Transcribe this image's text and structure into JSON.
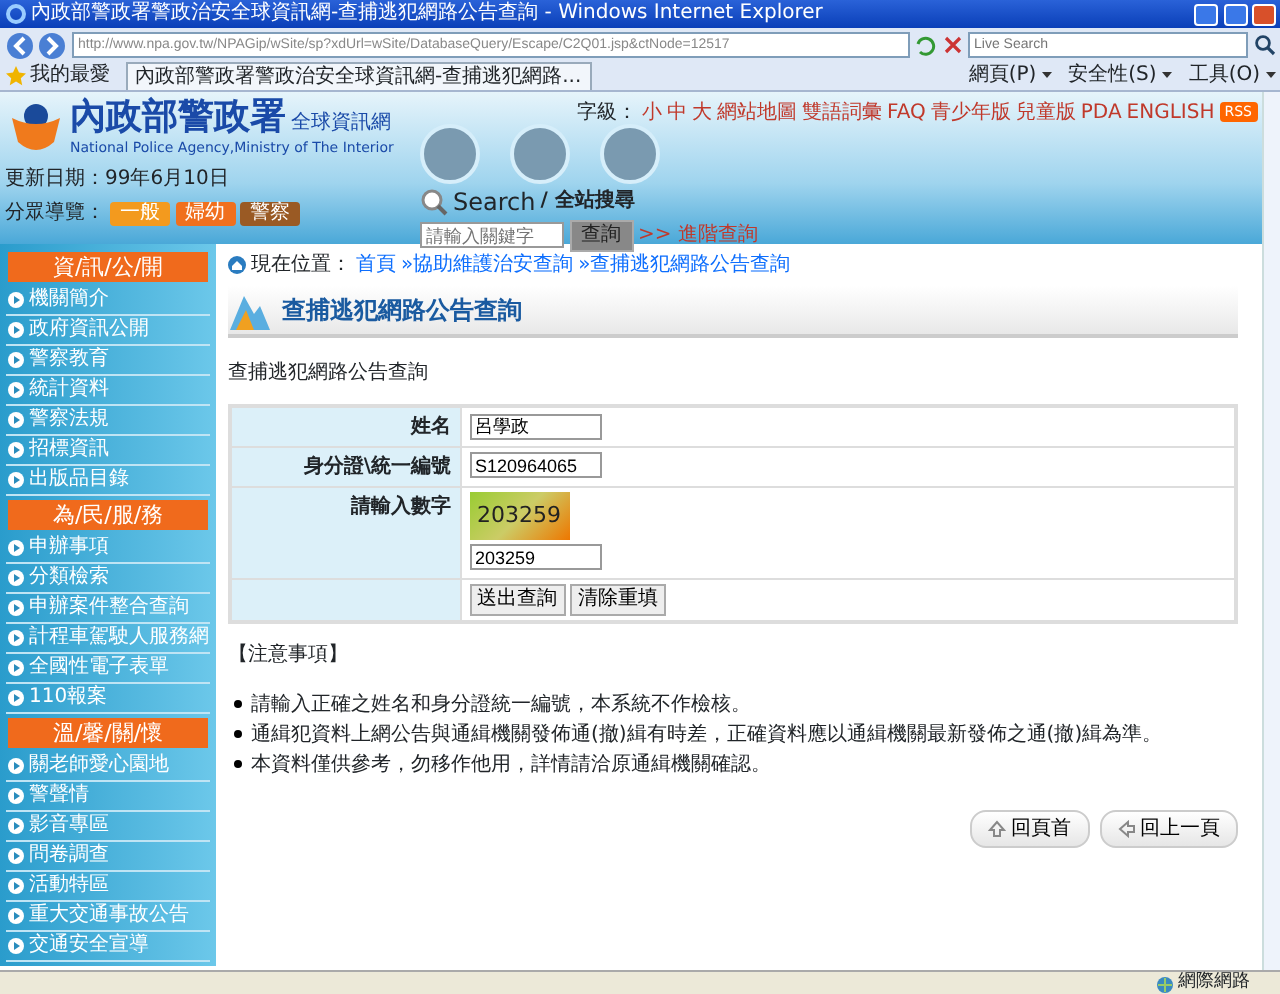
{
  "window": {
    "title": "內政部警政署警政治安全球資訊網-查捕逃犯網路公告查詢 - Windows Internet Explorer"
  },
  "browser": {
    "address": "http://www.npa.gov.tw/NPAGip/wSite/sp?xdUrl=wSite/DatabaseQuery/Escape/C2Q01.jsp&ctNode=12517",
    "search_placeholder": "Live Search",
    "favorites": "我的最愛",
    "tab_title": "內政部警政署警政治安全球資訊網-查捕逃犯網路...",
    "menus": [
      "網頁(P)",
      "安全性(S)",
      "工具(O)"
    ]
  },
  "header": {
    "font_size_label": "字級：",
    "font_sizes": [
      "小",
      "中",
      "大"
    ],
    "links": [
      "網站地圖",
      "雙語詞彙",
      "FAQ",
      "青少年版",
      "兒童版",
      "PDA",
      "ENGLISH"
    ],
    "rss": "RSS",
    "logo_title": "內政部警政署",
    "logo_subtitle": "全球資訊網",
    "logo_en": "National Police Agency,Ministry of The Interior",
    "updated": "更新日期：99年6月10日",
    "audience_label": "分眾導覽：",
    "audience": [
      {
        "label": "一般",
        "color": "#f39a1e"
      },
      {
        "label": "婦幼",
        "color": "#f0701e"
      },
      {
        "label": "警察",
        "color": "#9a5a24"
      }
    ],
    "search_title": "Search",
    "search_sub": "/ 全站搜尋",
    "search_placeholder": "請輸入關鍵字",
    "search_button": "查詢",
    "advanced": ">> 進階查詢"
  },
  "sidebar": {
    "sections": [
      {
        "title": "資/訊/公/開",
        "items": [
          "機關簡介",
          "政府資訊公開",
          "警察教育",
          "統計資料",
          "警察法規",
          "招標資訊",
          "出版品目錄"
        ]
      },
      {
        "title": "為/民/服/務",
        "items": [
          "申辦事項",
          "分類檢索",
          "申辦案件整合查詢",
          "計程車駕駛人服務網",
          "全國性電子表單",
          "110報案"
        ]
      },
      {
        "title": "溫/馨/關/懷",
        "items": [
          "關老師愛心園地",
          "警聲情",
          "影音專區",
          "問卷調查",
          "活動特區",
          "重大交通事故公告",
          "交通安全宣導"
        ]
      }
    ]
  },
  "breadcrumb": {
    "label": "現在位置：",
    "items": [
      "首頁",
      "»協助維護治安查詢",
      "»查捕逃犯網路公告查詢"
    ]
  },
  "page_title": "查捕逃犯網路公告查詢",
  "intro": "查捕逃犯網路公告查詢",
  "form": {
    "fields": [
      {
        "kind": "text",
        "label": "姓名",
        "value": "呂學政"
      },
      {
        "kind": "text",
        "label": "身分證\\統一編號",
        "value": "S120964065"
      },
      {
        "kind": "captcha",
        "label": "請輸入數字",
        "code": "203259",
        "value": "203259"
      }
    ],
    "buttons": [
      "送出查詢",
      "清除重填"
    ]
  },
  "notes": {
    "title": "【注意事項】",
    "items": [
      "請輸入正確之姓名和身分證統一編號，本系統不作檢核。",
      "通緝犯資料上網公告與通緝機關發佈通(撤)緝有時差，正確資料應以通緝機關最新發佈之通(撤)緝為準。",
      "本資料僅供參考，勿移作他用，詳情請洽原通緝機關確認。"
    ]
  },
  "nav_buttons": [
    "回頁首",
    "回上一頁"
  ],
  "status": {
    "zone": "網際網路"
  }
}
